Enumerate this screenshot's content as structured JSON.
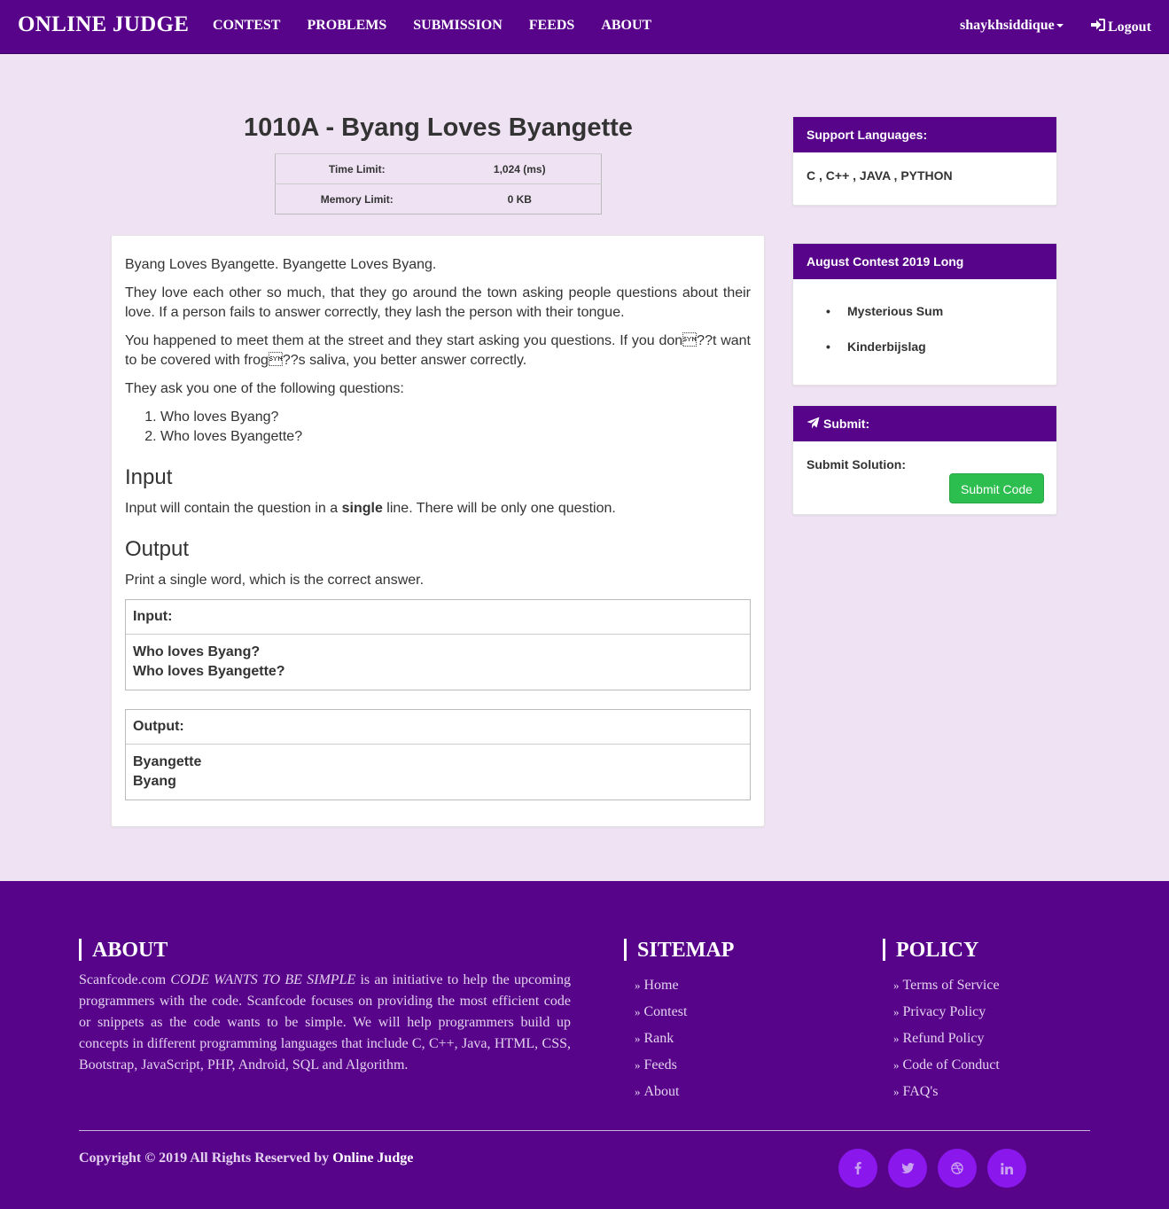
{
  "navbar": {
    "brand": "ONLINE JUDGE",
    "links": [
      "CONTEST",
      "PROBLEMS",
      "SUBMISSION",
      "FEEDS",
      "ABOUT"
    ],
    "user": "shaykhsiddique",
    "logout": "Logout"
  },
  "problem": {
    "title": "1010A - Byang Loves Byangette",
    "limits": [
      {
        "label": "Time Limit:",
        "value": "1,024 (ms)"
      },
      {
        "label": "Memory Limit:",
        "value": "0 KB"
      }
    ],
    "paragraphs": [
      "Byang Loves Byangette. Byangette Loves Byang.",
      "They love each other so much, that they go around the town asking people questions about their love. If a person fails to answer correctly, they lash the person with their tongue.",
      "You happened to meet them at the street and they start asking you questions. If you don\u0016??t want to be covered with frog\u0016??s saliva, you better answer correctly.",
      "They ask you one of the following questions:"
    ],
    "questions": [
      "Who loves Byang?",
      "Who loves Byangette?"
    ],
    "input_heading": "Input",
    "input_text_pre": "Input will contain the question in a ",
    "input_text_bold": "single",
    "input_text_post": " line. There will be only one question.",
    "output_heading": "Output",
    "output_text": "Print a single word, which is the correct answer.",
    "sample_input_label": "Input:",
    "sample_input_lines": [
      "Who loves Byang?",
      "Who loves Byangette?"
    ],
    "sample_output_label": "Output:",
    "sample_output_lines": [
      "Byangette",
      "Byang"
    ]
  },
  "sidebar": {
    "languages_title": "Support Languages:",
    "languages": "C , C++ , JAVA , PYTHON",
    "contest_title": "August Contest 2019 Long",
    "contest_problems": [
      "Mysterious Sum",
      "Kinderbijslag"
    ],
    "submit_title": "Submit:",
    "submit_label": "Submit Solution:",
    "submit_button": "Submit Code"
  },
  "footer": {
    "about_title": "ABOUT",
    "about_text_pre": "Scanfcode.com ",
    "about_text_em": "CODE WANTS TO BE SIMPLE",
    "about_text_post": " is an initiative to help the upcoming programmers with the code. Scanfcode focuses on providing the most efficient code or snippets as the code wants to be simple. We will help programmers build up concepts in different programming languages that include C, C++, Java, HTML, CSS, Bootstrap, JavaScript, PHP, Android, SQL and Algorithm.",
    "sitemap_title": "SITEMAP",
    "sitemap_links": [
      "Home",
      "Contest",
      "Rank",
      "Feeds",
      "About"
    ],
    "policy_title": "POLICY",
    "policy_links": [
      "Terms of Service",
      "Privacy Policy",
      "Refund Policy",
      "Code of Conduct",
      "FAQ's"
    ],
    "copyright_pre": "Copyright © 2019 All Rights Reserved by ",
    "copyright_brand": "Online Judge",
    "social_icons": [
      "facebook-icon",
      "twitter-icon",
      "dribbble-icon",
      "linkedin-icon"
    ]
  },
  "colors": {
    "brand_purple": "#57038a",
    "page_background": "#efe3f3",
    "submit_green": "#2cbe4e",
    "social_circle": "#8a17ec"
  }
}
